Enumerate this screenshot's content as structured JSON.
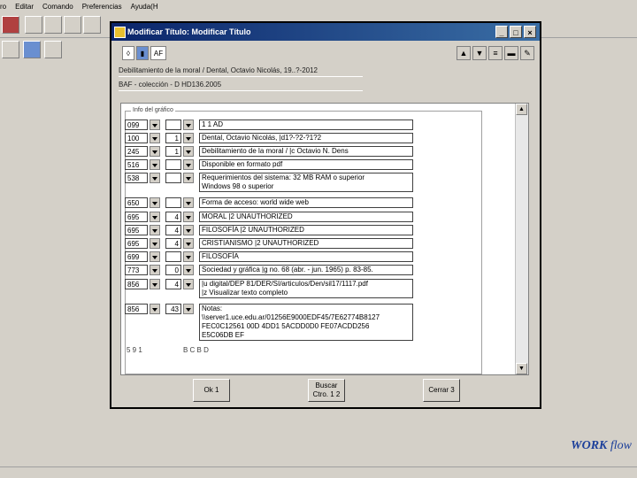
{
  "menu": {
    "items": [
      "ro",
      "Editar",
      "Comando",
      "Preferencias",
      "Ayuda(H"
    ]
  },
  "dialog": {
    "title": "Modificar Título: Modificar Título",
    "info_line1": "Debilitamiento de la moral / Dental, Octavio Nicolás, 19..?-2012",
    "info_line2": "BAF - colección - D HD136.2005",
    "group_label": "Info del gráfico",
    "rows": [
      {
        "tag": "099",
        "ind1": "",
        "ind2": "",
        "value": "1 1 AD"
      },
      {
        "tag": "100",
        "ind1": "1",
        "ind2": "",
        "value": "Dental, Octavio Nicolás, |d1?-?2-?1?2"
      },
      {
        "tag": "245",
        "ind1": "1",
        "ind2": "0",
        "value": "Debilitamiento de la moral / |c Octavio N. Dens"
      },
      {
        "tag": "516",
        "ind1": "",
        "ind2": "",
        "value": "Disponible en formato pdf"
      },
      {
        "tag": "538",
        "ind1": "",
        "ind2": "",
        "value": "Requerimientos del sistema: 32 MB RAM o superior\nWindows 98 o superior"
      },
      {
        "tag": "650",
        "ind1": "",
        "ind2": "",
        "value": "Forma de acceso: world wide web"
      },
      {
        "tag": "695",
        "ind1": "",
        "ind2": "4",
        "value": "MORAL |2 UNAUTHORIZED"
      },
      {
        "tag": "695",
        "ind1": "",
        "ind2": "4",
        "value": "FILOSOFÍA |2 UNAUTHORIZED"
      },
      {
        "tag": "695",
        "ind1": "",
        "ind2": "4",
        "value": "CRISTIANISMO |2 UNAUTHORIZED"
      },
      {
        "tag": "699",
        "ind1": "",
        "ind2": "",
        "value": "FILOSOFÍA"
      },
      {
        "tag": "773",
        "ind1": "",
        "ind2": "0",
        "value": "Sociedad y gráfica |g no. 68 (abr. - jun. 1965) p. 83-85."
      },
      {
        "tag": "856",
        "ind1": "4",
        "ind2": "1",
        "value": "|u digital/DEP 81/DER/SI/articulos/Den/sil17/1117.pdf\n|z Visualizar texto completo"
      },
      {
        "tag": "856",
        "ind1": "",
        "ind2": "43",
        "value": "Notas:\n\\\\server1.uce.edu.ar/01256E9000EDF45/7E62774B8127\nFEC0C12561 00D 4DD1 5ACDD0D0 FE07ACDD256\nE5C06DB EF"
      }
    ],
    "footer_left": "5 9 1",
    "footer_right": "B C B D",
    "buttons": {
      "ok": "Ok 1",
      "search": "Buscar\nCtro. 1 2",
      "close": "Cerrar 3"
    }
  },
  "logo": {
    "text": "WORK",
    "suffix": "flow"
  }
}
